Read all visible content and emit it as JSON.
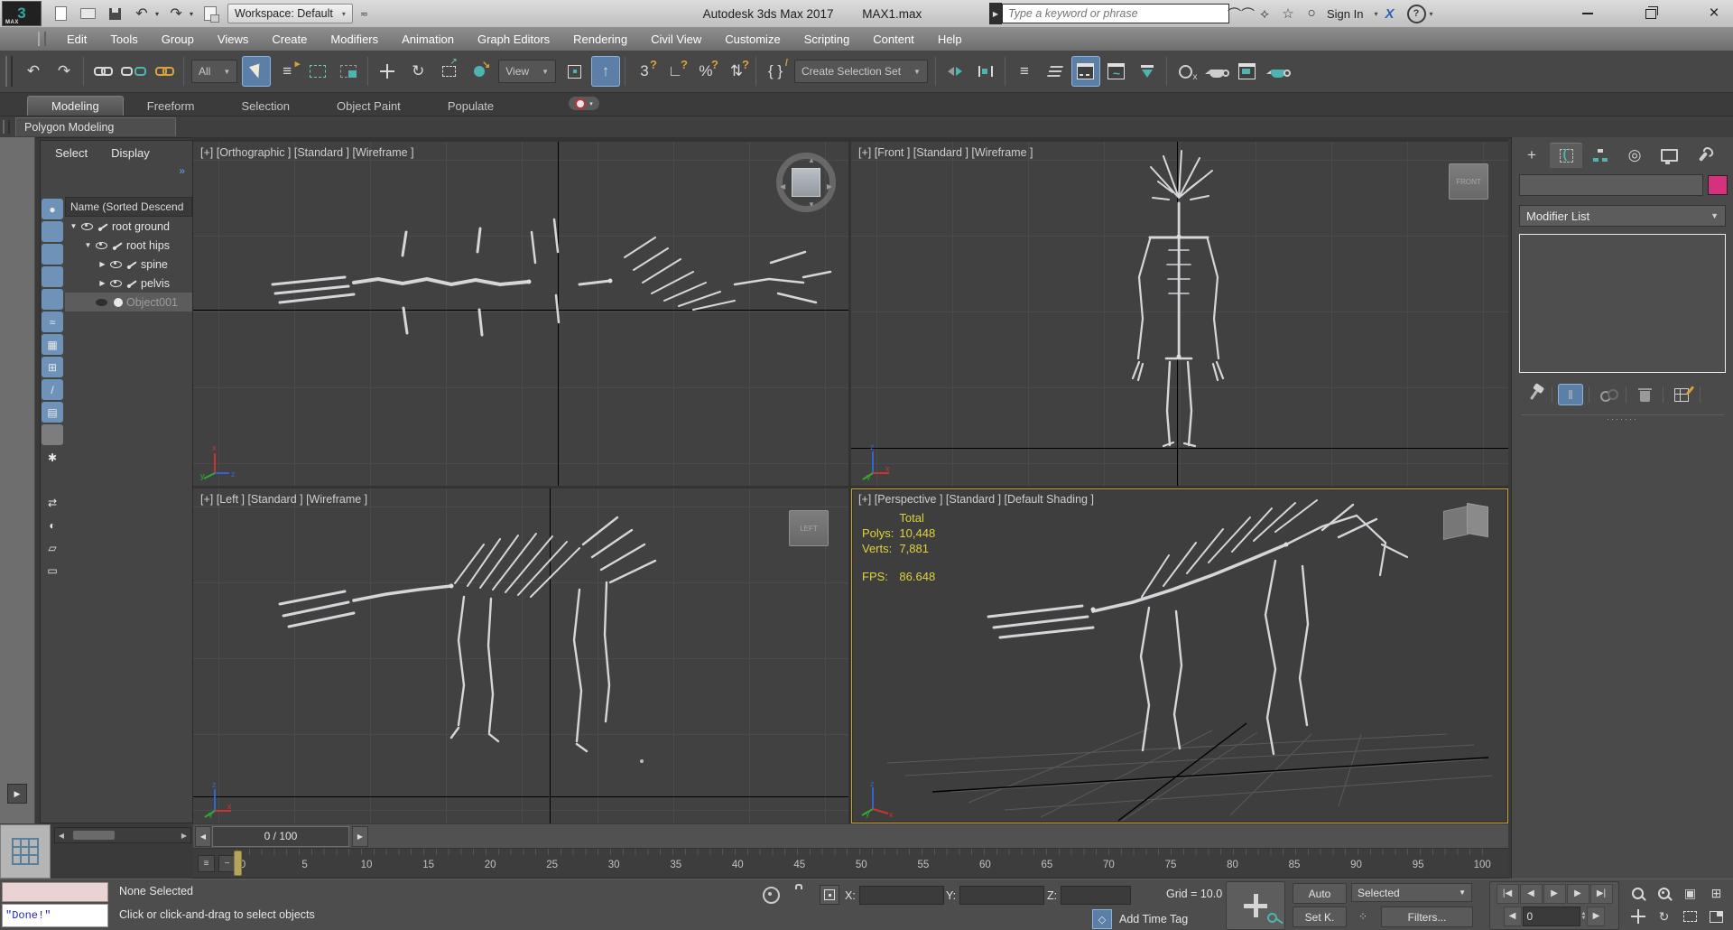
{
  "titlebar": {
    "logo": "3",
    "logo_sub": "MAX",
    "workspace": "Workspace: Default",
    "title_app": "Autodesk 3ds Max 2017",
    "title_file": "MAX1.max",
    "search_placeholder": "Type a keyword or phrase",
    "sign_in": "Sign In",
    "exchange": "X",
    "help": "?"
  },
  "menubar": {
    "items": [
      {
        "name": "edit",
        "label": "Edit"
      },
      {
        "name": "tools",
        "label": "Tools"
      },
      {
        "name": "group",
        "label": "Group"
      },
      {
        "name": "views",
        "label": "Views"
      },
      {
        "name": "create",
        "label": "Create"
      },
      {
        "name": "modifiers",
        "label": "Modifiers"
      },
      {
        "name": "animation",
        "label": "Animation"
      },
      {
        "name": "graph-editors",
        "label": "Graph Editors"
      },
      {
        "name": "rendering",
        "label": "Rendering"
      },
      {
        "name": "civil-view",
        "label": "Civil View"
      },
      {
        "name": "customize",
        "label": "Customize"
      },
      {
        "name": "scripting",
        "label": "Scripting"
      },
      {
        "name": "content",
        "label": "Content"
      },
      {
        "name": "help",
        "label": "Help"
      }
    ]
  },
  "toolbar": {
    "items": [
      {
        "t": "btn",
        "name": "undo",
        "g": "↶"
      },
      {
        "t": "btn",
        "name": "redo",
        "g": "↷"
      },
      {
        "t": "div"
      },
      {
        "t": "btn",
        "name": "select-and-link",
        "shape": "s-link"
      },
      {
        "t": "btn",
        "name": "unlink-selection",
        "shape": "s-unlink"
      },
      {
        "t": "btn",
        "name": "bind-to-space-warp",
        "shape": "s-bind"
      },
      {
        "t": "div"
      },
      {
        "t": "dd",
        "name": "selection-filter",
        "label": "All"
      },
      {
        "t": "btn",
        "name": "select-object",
        "shape": "s-cursor",
        "active": true
      },
      {
        "t": "btn",
        "name": "select-by-name",
        "g": "≡",
        "ov": "▸"
      },
      {
        "t": "btn",
        "name": "rectangular-selection-region",
        "shape": "s-region"
      },
      {
        "t": "btn",
        "name": "window-crossing",
        "shape": "s-crossing"
      },
      {
        "t": "div"
      },
      {
        "t": "btn",
        "name": "select-and-move",
        "shape": "s-move"
      },
      {
        "t": "btn",
        "name": "select-and-rotate",
        "g": "↻"
      },
      {
        "t": "btn",
        "name": "select-and-scale",
        "shape": "s-scale"
      },
      {
        "t": "btn",
        "name": "select-and-place",
        "shape": "s-place"
      },
      {
        "t": "dd",
        "name": "reference-coordinate-system",
        "label": "View"
      },
      {
        "t": "btn",
        "name": "use-pivot-point-center",
        "shape": "s-pivot"
      },
      {
        "t": "btn",
        "name": "select-and-manipulate",
        "g": "↑",
        "active": true
      },
      {
        "t": "div"
      },
      {
        "t": "btn",
        "name": "snap-toggle-3d",
        "g": "3",
        "ov": "?",
        "ovbig": true
      },
      {
        "t": "btn",
        "name": "angle-snap-toggle",
        "g": "∟",
        "ov": "?",
        "ovbig": true
      },
      {
        "t": "btn",
        "name": "percent-snap-toggle",
        "g": "%",
        "ov": "?",
        "ovbig": true
      },
      {
        "t": "btn",
        "name": "spinner-snap-toggle",
        "g": "⇅",
        "ov": "?",
        "ovbig": true
      },
      {
        "t": "div"
      },
      {
        "t": "btn",
        "name": "edit-named-selection-sets",
        "g": "{ }",
        "ov": "/"
      },
      {
        "t": "dd",
        "name": "create-selection-set",
        "label": "Create Selection Set"
      },
      {
        "t": "div"
      },
      {
        "t": "btn",
        "name": "mirror",
        "shape": "s-mirror"
      },
      {
        "t": "btn",
        "name": "align",
        "shape": "s-align"
      },
      {
        "t": "div"
      },
      {
        "t": "btn",
        "name": "layer-explorer",
        "g": "≡"
      },
      {
        "t": "btn",
        "name": "scene-explorer-toggle",
        "shape": "s-layers"
      },
      {
        "t": "btn",
        "name": "ribbon-toggle",
        "shape": "s-window",
        "active": true
      },
      {
        "t": "btn",
        "name": "curve-editor",
        "shape": "s-curvewin"
      },
      {
        "t": "btn",
        "name": "schematic-view",
        "shape": "s-download"
      },
      {
        "t": "div"
      },
      {
        "t": "btn",
        "name": "material-editor",
        "shape": "s-material"
      },
      {
        "t": "btn",
        "name": "render-setup",
        "shape": "s-teapot"
      },
      {
        "t": "btn",
        "name": "rendered-frame-window",
        "shape": "s-framewin"
      },
      {
        "t": "btn",
        "name": "render-production",
        "shape": "s-teapot teal"
      }
    ]
  },
  "ribbon": {
    "tabs": [
      {
        "name": "modeling",
        "label": "Modeling",
        "active": true
      },
      {
        "name": "freeform",
        "label": "Freeform"
      },
      {
        "name": "selection",
        "label": "Selection"
      },
      {
        "name": "object-paint",
        "label": "Object Paint"
      },
      {
        "name": "populate",
        "label": "Populate"
      }
    ],
    "panel_title": "Polygon Modeling"
  },
  "explorer": {
    "menu_select": "Select",
    "menu_display": "Display",
    "more": "»",
    "header": "Name (Sorted Descend",
    "strip": [
      {
        "name": "display-geometry",
        "g": "●",
        "state": "on"
      },
      {
        "name": "display-shapes",
        "shape": "s-shapes",
        "state": "on"
      },
      {
        "name": "display-lights",
        "shape": "s-bulb",
        "state": "on"
      },
      {
        "name": "display-cameras",
        "shape": "s-camera",
        "state": "on"
      },
      {
        "name": "display-helpers",
        "shape": "s-helper",
        "state": "on"
      },
      {
        "name": "display-space-warps",
        "g": "≈",
        "state": "on"
      },
      {
        "name": "display-groups",
        "g": "▦",
        "state": "on"
      },
      {
        "name": "display-xrefs",
        "g": "⊞",
        "state": "on"
      },
      {
        "name": "display-bones",
        "g": "/",
        "state": "on"
      },
      {
        "name": "display-containers",
        "g": "▤",
        "state": "on"
      },
      {
        "name": "display-hidden",
        "shape": "s-eyebtn",
        "state": "pressed"
      },
      {
        "name": "display-frozen",
        "g": "✱",
        "state": "off"
      },
      {
        "name": "lock-cell-editing",
        "shape": "s-lockbtn",
        "state": "off"
      },
      {
        "name": "sync-selection",
        "g": "⇄",
        "state": "off"
      },
      {
        "name": "display-materials",
        "g": "◐",
        "state": "off"
      },
      {
        "name": "pick-mode",
        "g": "▱",
        "state": "off"
      },
      {
        "name": "explorer-settings",
        "g": "▭",
        "state": "off"
      }
    ],
    "rows": [
      {
        "name": "root-ground",
        "label": "root ground",
        "level": 0,
        "arrow": "▼",
        "icon": "bone"
      },
      {
        "name": "root-hips",
        "label": "root hips",
        "level": 1,
        "arrow": "▼",
        "icon": "bone"
      },
      {
        "name": "spine",
        "label": "spine",
        "level": 2,
        "arrow": "▶",
        "icon": "bone"
      },
      {
        "name": "pelvis",
        "label": "pelvis",
        "level": 2,
        "arrow": "▶",
        "icon": "bone"
      },
      {
        "name": "object001",
        "label": "Object001",
        "level": 1,
        "arrow": "",
        "icon": "sphere",
        "dimmed": true,
        "selected": true,
        "eyeclosed": true
      }
    ]
  },
  "viewports": {
    "ortho_label": "[+] [Orthographic ] [Standard ] [Wireframe ]",
    "front_label": "[+] [Front ] [Standard ] [Wireframe ]",
    "left_label": "[+] [Left ] [Standard ] [Wireframe ]",
    "persp_label": "[+] [Perspective ] [Standard ] [Default Shading ]",
    "viewcube_front": "FRONT",
    "viewcube_left": "LEFT",
    "stats": {
      "total_header": "Total",
      "polys_label": "Polys:",
      "polys_value": "10,448",
      "verts_label": "Verts:",
      "verts_value": "7,881",
      "fps_label": "FPS:",
      "fps_value": "86.648"
    },
    "axis_x": "x",
    "axis_y": "y",
    "axis_z": "z"
  },
  "timeline": {
    "slider": "0 / 100",
    "ticks": [
      "0",
      "5",
      "10",
      "15",
      "20",
      "25",
      "30",
      "35",
      "40",
      "45",
      "50",
      "55",
      "60",
      "65",
      "70",
      "75",
      "80",
      "85",
      "90",
      "95",
      "100"
    ]
  },
  "statusbar": {
    "listener_text": "\"Done!\"",
    "status": "None Selected",
    "prompt": "Click or click-and-drag to select objects",
    "x_label": "X:",
    "y_label": "Y:",
    "z_label": "Z:",
    "grid": "Grid = 10.0",
    "add_time_tag": "Add Time Tag",
    "auto": "Auto",
    "set_key": "Set K.",
    "selected": "Selected",
    "filters": "Filters...",
    "frame_value": "0",
    "playback": [
      {
        "name": "go-to-start",
        "g": "|◀"
      },
      {
        "name": "previous-frame",
        "g": "◀"
      },
      {
        "name": "play-animation",
        "g": "▶"
      },
      {
        "name": "next-frame",
        "g": "▶"
      },
      {
        "name": "go-to-end",
        "g": "▶|"
      }
    ],
    "nav": [
      {
        "name": "zoom",
        "shape": "s-mag"
      },
      {
        "name": "zoom-all",
        "shape": "s-mag all"
      },
      {
        "name": "zoom-extents",
        "g": "▣"
      },
      {
        "name": "zoom-extents-all",
        "g": "⊞"
      },
      {
        "name": "pan-view",
        "shape": "s-move"
      },
      {
        "name": "orbit",
        "g": "↻"
      },
      {
        "name": "zoom-region",
        "shape": "s-regionz"
      },
      {
        "name": "maximize-viewport-toggle",
        "shape": "s-maxtog"
      }
    ]
  },
  "command_panel": {
    "tabs": [
      {
        "name": "create",
        "g": "+"
      },
      {
        "name": "modify",
        "shape": "s-modify",
        "active": true
      },
      {
        "name": "hierarchy",
        "shape": "s-hier"
      },
      {
        "name": "motion",
        "g": "◎"
      },
      {
        "name": "display",
        "shape": "s-monitor"
      },
      {
        "name": "utilities",
        "shape": "s-wrench"
      }
    ],
    "modifier_list": "Modifier List",
    "swatch_color": "#d6317e",
    "stack_buttons": [
      {
        "name": "pin-stack",
        "shape": "s-pin"
      },
      {
        "name": "show-end-result",
        "g": "‖",
        "active": true
      },
      {
        "name": "make-unique",
        "shape": "s-unique"
      },
      {
        "name": "remove-modifier",
        "shape": "s-trash"
      },
      {
        "name": "configure-modifier-sets",
        "shape": "s-config"
      }
    ],
    "splitter_dots": "·······"
  },
  "colors": {
    "active_viewport_border": "#c9a348",
    "stats_yellow": "#ded33a",
    "accent_blue": "#5b7fa6",
    "teal": "#4fb3af",
    "gold": "#d9a33c"
  }
}
